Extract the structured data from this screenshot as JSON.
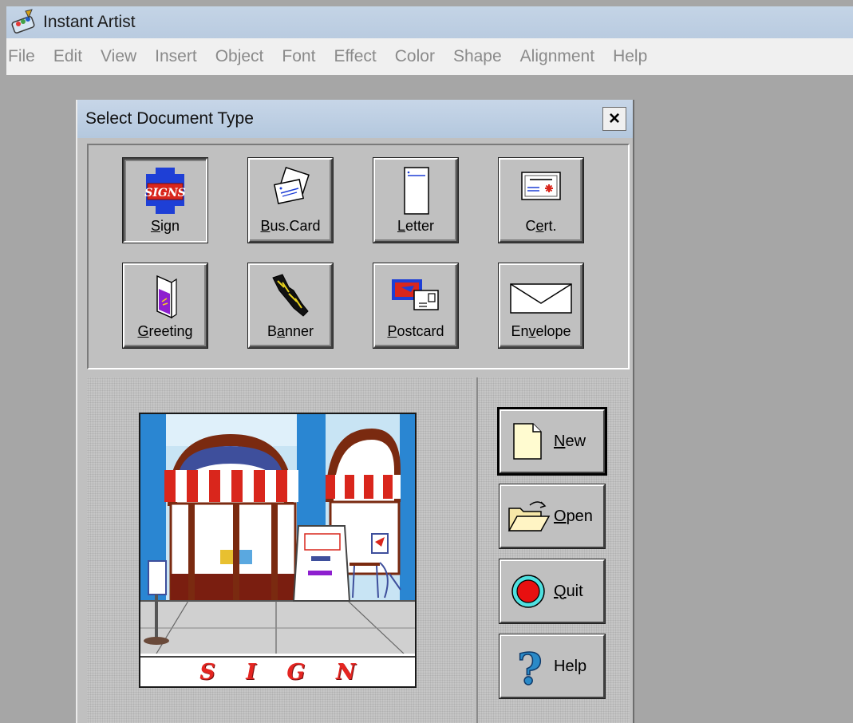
{
  "app": {
    "title": "Instant Artist",
    "icon": "instant-artist-icon"
  },
  "menu": [
    "File",
    "Edit",
    "View",
    "Insert",
    "Object",
    "Font",
    "Effect",
    "Color",
    "Shape",
    "Alignment",
    "Help"
  ],
  "dialog": {
    "title": "Select Document Type",
    "close_label": "×",
    "document_types": [
      {
        "id": "sign",
        "label": "Sign",
        "underline": "S",
        "icon": "signs-icon",
        "selected": true
      },
      {
        "id": "business-card",
        "label": "Bus.Card",
        "underline": "B",
        "icon": "business-card-icon",
        "selected": false
      },
      {
        "id": "letter",
        "label": "Letter",
        "underline": "L",
        "icon": "letter-icon",
        "selected": false
      },
      {
        "id": "certificate",
        "label": "Cert.",
        "underline": "e",
        "icon": "certificate-icon",
        "selected": false
      },
      {
        "id": "greeting",
        "label": "Greeting",
        "underline": "G",
        "icon": "greeting-card-icon",
        "selected": false
      },
      {
        "id": "banner",
        "label": "Banner",
        "underline": "a",
        "icon": "banner-icon",
        "selected": false
      },
      {
        "id": "postcard",
        "label": "Postcard",
        "underline": "P",
        "icon": "postcard-icon",
        "selected": false
      },
      {
        "id": "envelope",
        "label": "Envelope",
        "underline": "v",
        "icon": "envelope-icon",
        "selected": false
      }
    ],
    "preview": {
      "image": "restaurant-storefront-illustration",
      "caption_letters": [
        "S",
        "I",
        "G",
        "N"
      ]
    },
    "actions": [
      {
        "id": "new",
        "label": "New",
        "underline": "N",
        "icon": "new-document-icon",
        "default": true
      },
      {
        "id": "open",
        "label": "Open",
        "underline": "O",
        "icon": "open-folder-icon",
        "default": false
      },
      {
        "id": "quit",
        "label": "Quit",
        "underline": "Q",
        "icon": "quit-stop-icon",
        "default": false
      },
      {
        "id": "help",
        "label": "Help",
        "underline": "",
        "icon": "help-question-icon",
        "default": false
      }
    ]
  },
  "colors": {
    "desktop": "#a6a6a6",
    "titlebar": "#c4d4e6",
    "dialog_face": "#c0c0c0",
    "caption_red": "#e52521"
  }
}
